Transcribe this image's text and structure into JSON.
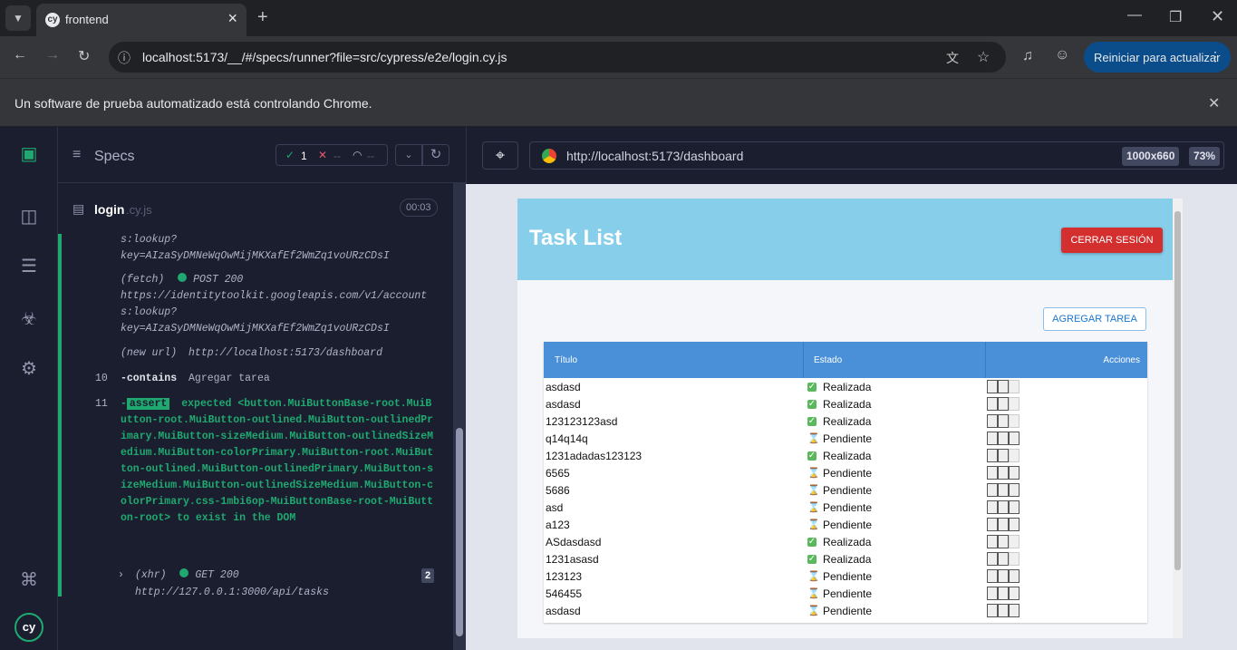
{
  "browser": {
    "tab_title": "frontend",
    "url": "localhost:5173/__/#/specs/runner?file=src/cypress/e2e/login.cy.js",
    "update_button": "Reiniciar para actualizar",
    "infobar_text": "Un software de prueba automatizado está controlando Chrome."
  },
  "reporter": {
    "specs_label": "Specs",
    "passed": "1",
    "failed": "--",
    "pending": "--",
    "spec_name": "login",
    "spec_ext": ".cy.js",
    "duration": "00:03",
    "log": {
      "l1": "s:lookup?",
      "l2": "key=AIzaSyDMNeWqOwMijMKXafEf2WmZq1voURzCDsI",
      "fetch_type": "(fetch)",
      "fetch_method": "POST 200",
      "fetch_url1": "https://identitytoolkit.googleapis.com/v1/account",
      "fetch_url2": "s:lookup?",
      "fetch_url3": "key=AIzaSyDMNeWqOwMijMKXafEf2WmZq1voURzCDsI",
      "newurl_type": "(new url)",
      "newurl": "http://localhost:5173/dashboard",
      "c10_num": "10",
      "c10_cmd": "-contains",
      "c10_arg": "Agregar tarea",
      "c11_num": "11",
      "c11_dash": "-",
      "c11_cmd": "assert",
      "c11_text": "expected <button.MuiButtonBase-root.MuiButton-root.MuiButton-outlined.MuiButton-outlinedPrimary.MuiButton-sizeMedium.MuiButton-outlinedSizeMedium.MuiButton-colorPrimary.MuiButton-root.MuiButton-outlined.MuiButton-outlinedPrimary.MuiButton-sizeMedium.MuiButton-outlinedSizeMedium.MuiButton-colorPrimary.css-1mbi6op-MuiButtonBase-root-MuiButton-root> to exist in the DOM",
      "xhr_type": "(xhr)",
      "xhr_method": "GET 200",
      "xhr_count": "2",
      "xhr_url": "http://127.0.0.1:3000/api/tasks"
    }
  },
  "aut": {
    "url": "http://localhost:5173/dashboard",
    "viewport": "1000x660",
    "zoom": "73%"
  },
  "app": {
    "title": "Task List",
    "logout_label": "CERRAR SESIÓN",
    "add_label": "AGREGAR TAREA",
    "col_title": "Título",
    "col_status": "Estado",
    "col_actions": "Acciones",
    "tasks": [
      {
        "title": "asdasd",
        "status": "Realizada"
      },
      {
        "title": "asdasd",
        "status": "Realizada"
      },
      {
        "title": "123123123asd",
        "status": "Realizada"
      },
      {
        "title": "q14q14q",
        "status": "Pendiente"
      },
      {
        "title": "1231adadas123123",
        "status": "Realizada"
      },
      {
        "title": "6565",
        "status": "Pendiente"
      },
      {
        "title": "5686",
        "status": "Pendiente"
      },
      {
        "title": "asd",
        "status": "Pendiente"
      },
      {
        "title": "a123",
        "status": "Pendiente"
      },
      {
        "title": "ASdasdasd",
        "status": "Realizada"
      },
      {
        "title": "1231asasd",
        "status": "Realizada"
      },
      {
        "title": "123123",
        "status": "Pendiente"
      },
      {
        "title": "546455",
        "status": "Pendiente"
      },
      {
        "title": "asdasd",
        "status": "Pendiente"
      }
    ]
  },
  "colors": {
    "done": "#5cb85c",
    "pending": "#c59a3c",
    "accent": "#1fa971"
  }
}
